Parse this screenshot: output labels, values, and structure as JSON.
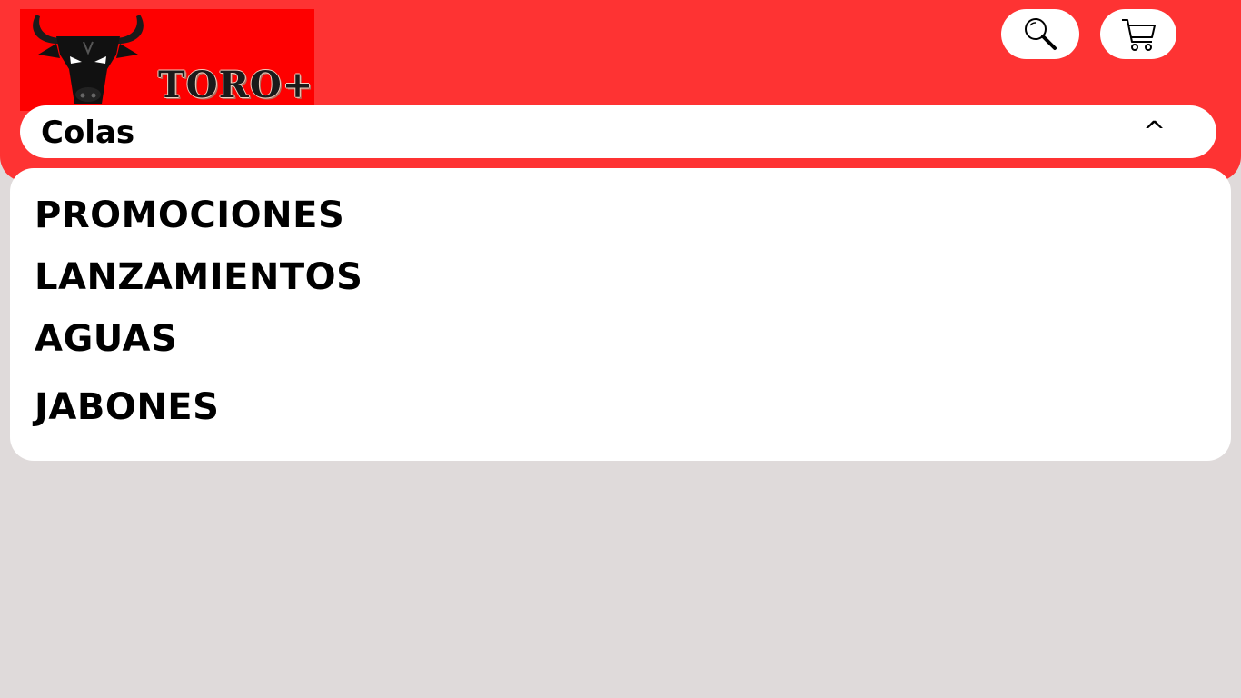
{
  "brand": {
    "name": "TORO+",
    "logo_bg": "#fe0000"
  },
  "header": {
    "bg_color": "#fe3333",
    "search_icon": "search-icon",
    "cart_icon": "cart-icon"
  },
  "category_selector": {
    "selected": "Colas",
    "toggle_symbol": "^",
    "expanded": true
  },
  "menu": {
    "items": [
      {
        "label": "PROMOCIONES"
      },
      {
        "label": "LANZAMIENTOS"
      },
      {
        "label": "AGUAS"
      },
      {
        "label": "JABONES"
      }
    ]
  },
  "colors": {
    "page_bg": "#dfdada",
    "accent": "#fe3333",
    "panel": "#ffffff"
  }
}
